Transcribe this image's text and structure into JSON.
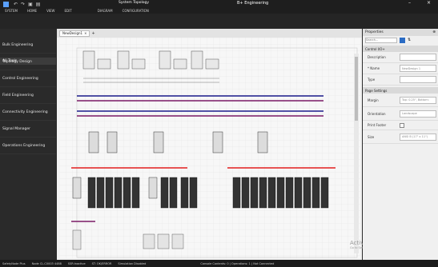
{
  "window": {
    "title": "B+ Engineering",
    "app_title": "System Topology",
    "design_tab_title": "NewDesign1"
  },
  "ribbon": {
    "tabs": [
      "SYSTEM",
      "HOME",
      "VIEW",
      "EDIT",
      "DIAGRAM",
      "CONFIGURATION"
    ]
  },
  "sidebar": {
    "header": "All Tools",
    "items": [
      {
        "label": "Bulk Engineering"
      },
      {
        "label": "Topology Design"
      },
      {
        "label": "Control Engineering"
      },
      {
        "label": "Field Engineering"
      },
      {
        "label": "Connectivity Engineering"
      },
      {
        "label": "Signal Manager"
      },
      {
        "label": "Operations Engineering"
      }
    ]
  },
  "editor": {
    "tab_label": "NewDesign1"
  },
  "properties": {
    "title": "Properties",
    "search_placeholder": "Search...",
    "control_section": "Control I/O+",
    "fields": [
      {
        "label": "Description",
        "value": ""
      },
      {
        "label": "* Name",
        "value": "NewDesign 1"
      },
      {
        "label": "Type",
        "value": ""
      }
    ],
    "page_section": "Page Settings",
    "page_fields": [
      {
        "label": "Margin",
        "value": "Top: 0.25\", Bottom:"
      },
      {
        "label": "Orientation",
        "value": "Landscape"
      },
      {
        "label": "Print Footer",
        "value": ""
      },
      {
        "label": "Size",
        "value": "ANSI B (17\" x 11\")"
      }
    ]
  },
  "status": {
    "items": [
      "SafetyNode Plus",
      "Node CL-C0003 4488",
      "SSR:Inactive",
      "ST: OK/ERROR",
      "Simulation Disabled",
      "Console Contents: 0 | Operations: 1 | Not Connected"
    ]
  },
  "watermark": {
    "line1": "Activate Windows",
    "line2": "Go to Settings to activate Windows."
  },
  "colors": {
    "bus_navy": "#1c1c8c",
    "bus_red": "#e21d1d",
    "bus_purple": "#7a1a66",
    "accent": "#2b6cc4"
  }
}
